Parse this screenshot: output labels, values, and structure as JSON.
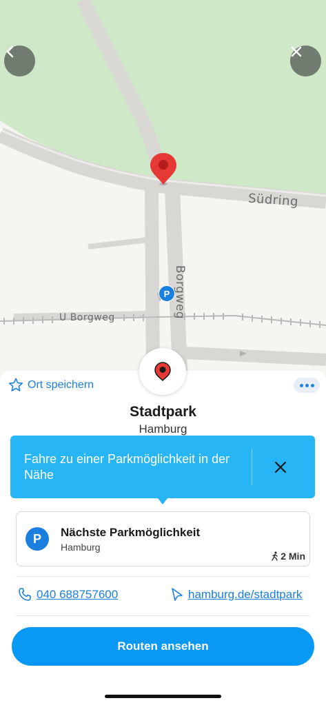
{
  "map": {
    "street_suedring": "Südring",
    "street_borgweg": "Borgweg",
    "station_label": "U Borgweg",
    "parking_marker": "P",
    "colors": {
      "park": "#cfe8c8",
      "road": "#d8d7d3",
      "land": "#f6f5f1",
      "pin": "#e53935"
    }
  },
  "nav": {
    "back_icon": "chevron-left-icon",
    "close_icon": "close-icon"
  },
  "place": {
    "save_label": "Ort speichern",
    "title": "Stadtpark",
    "city": "Hamburg"
  },
  "tooltip": {
    "text": "Fahre zu einer Parkmöglichkeit in der Nähe"
  },
  "parking": {
    "badge": "P",
    "title": "Nächste Parkmöglichkeit",
    "city": "Hamburg",
    "walk_time": "2 Min"
  },
  "contact": {
    "phone": "040 688757600",
    "website": "hamburg.de/stadtpark"
  },
  "actions": {
    "routes_label": "Routen ansehen"
  },
  "colors": {
    "accent": "#1b7fe0",
    "tooltip": "#27b5f5",
    "button": "#0a98f5"
  }
}
